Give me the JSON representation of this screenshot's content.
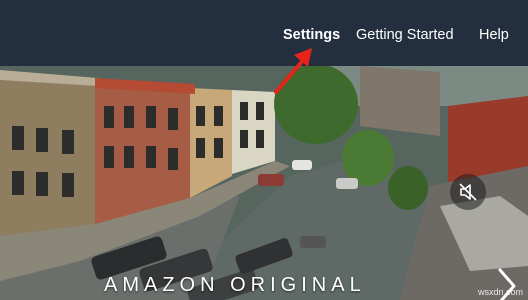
{
  "nav": {
    "links": [
      {
        "label": "Settings",
        "highlighted": true
      },
      {
        "label": "Getting Started"
      },
      {
        "label": "Help"
      }
    ]
  },
  "hero": {
    "title": "AMAZON ORIGINAL",
    "mute_icon": "speaker-muted-icon",
    "next_icon": "chevron-right-icon"
  },
  "annotation": {
    "arrow_color": "#e8231a"
  },
  "watermark": "wsxdn.com",
  "colors": {
    "navbar": "#232f3e",
    "text": "#ffffff"
  }
}
